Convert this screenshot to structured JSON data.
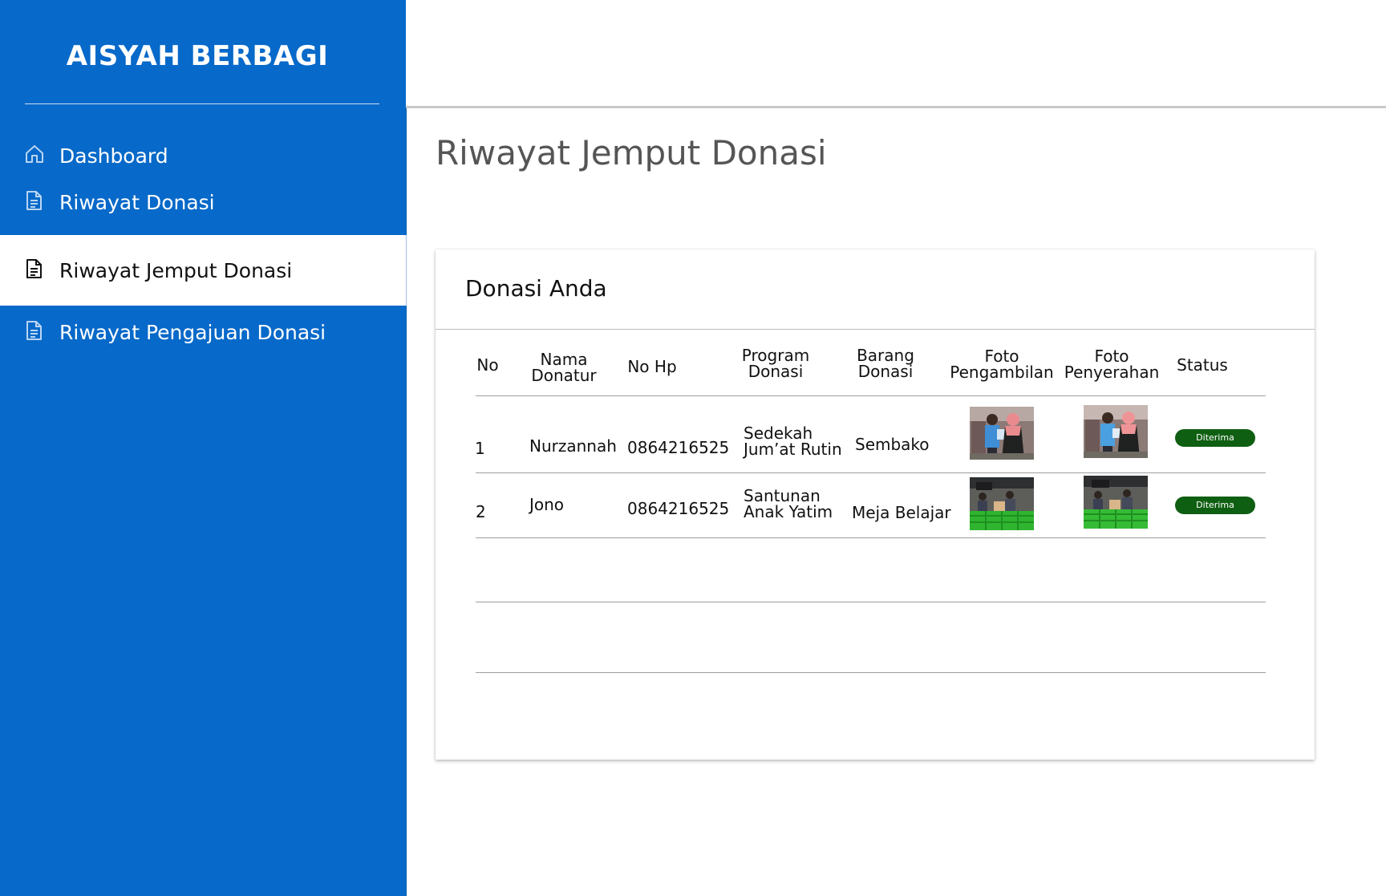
{
  "sidebar": {
    "brand": "AISYAH BERBAGI",
    "items": [
      {
        "label": "Dashboard",
        "icon": "home-icon"
      },
      {
        "label": "Riwayat Donasi",
        "icon": "document-icon"
      },
      {
        "label": "Riwayat Jemput Donasi",
        "icon": "document-icon",
        "active": true
      },
      {
        "label": "Riwayat Pengajuan Donasi",
        "icon": "document-icon"
      }
    ]
  },
  "page": {
    "title": "Riwayat Jemput Donasi"
  },
  "card": {
    "title": "Donasi Anda",
    "columns": [
      {
        "line1": "No",
        "line2": ""
      },
      {
        "line1": "Nama",
        "line2": "Donatur"
      },
      {
        "line1": "No Hp",
        "line2": ""
      },
      {
        "line1": "Program",
        "line2": "Donasi"
      },
      {
        "line1": "Barang",
        "line2": "Donasi"
      },
      {
        "line1": "Foto",
        "line2": "Pengambilan"
      },
      {
        "line1": "Foto",
        "line2": "Penyerahan"
      },
      {
        "line1": "Status",
        "line2": ""
      }
    ],
    "rows": [
      {
        "no": "1",
        "nama": "Nurzannah",
        "hp": "0864216525",
        "program_line1": "Sedekah",
        "program_line2": "Jum’at Rutin",
        "barang": "Sembako",
        "status": "Diterima"
      },
      {
        "no": "2",
        "nama": "Jono",
        "hp": "0864216525",
        "program_line1": "Santunan",
        "program_line2": "Anak Yatim",
        "barang": "Meja Belajar",
        "status": "Diterima"
      }
    ]
  },
  "colors": {
    "sidebar": "#0769c9",
    "badge": "#0f5f12",
    "title": "#555555"
  }
}
